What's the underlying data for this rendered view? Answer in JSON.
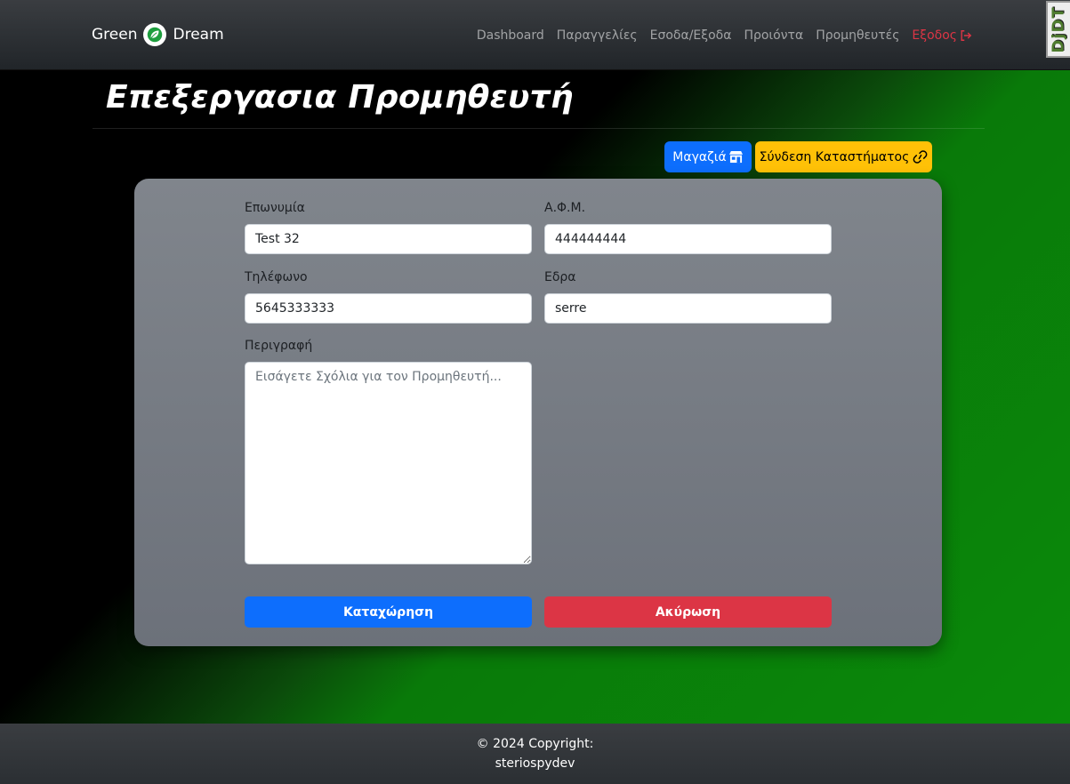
{
  "navbar": {
    "brand_left": "Green",
    "brand_right": "Dream",
    "links": [
      "Dashboard",
      "Παραγγελίες",
      "Εσοδα/Εξοδα",
      "Προιόντα",
      "Προμηθευτές"
    ],
    "logout_label": "Εξοδος",
    "logout_color": "#dc3545"
  },
  "debug_toolbar": {
    "label": "DjDT"
  },
  "page": {
    "title": "Επεξεργασια Προμηθευτή",
    "store_button": "Μαγαζιά",
    "link_button": "Σύνδεση Καταστήματος"
  },
  "form": {
    "name_label": "Επωνυμία",
    "name_value": "Test 32",
    "vat_label": "Α.Φ.Μ.",
    "vat_value": "444444444",
    "phone_label": "Τηλέφωνο",
    "phone_value": "5645333333",
    "seat_label": "Εδρα",
    "seat_value": "serre",
    "description_label": "Περιγραφή",
    "description_placeholder": "Εισάγετε Σχόλια για τον Προμηθευτή...",
    "description_value": "",
    "submit_label": "Καταχώρηση",
    "cancel_label": "Ακύρωση"
  },
  "footer": {
    "copyright": "© 2024 Copyright:",
    "author": "steriospydev"
  },
  "colors": {
    "primary": "#0d6efd",
    "warning": "#ffc107",
    "danger": "#dc3545",
    "brand_green": "#1e9e3e"
  }
}
